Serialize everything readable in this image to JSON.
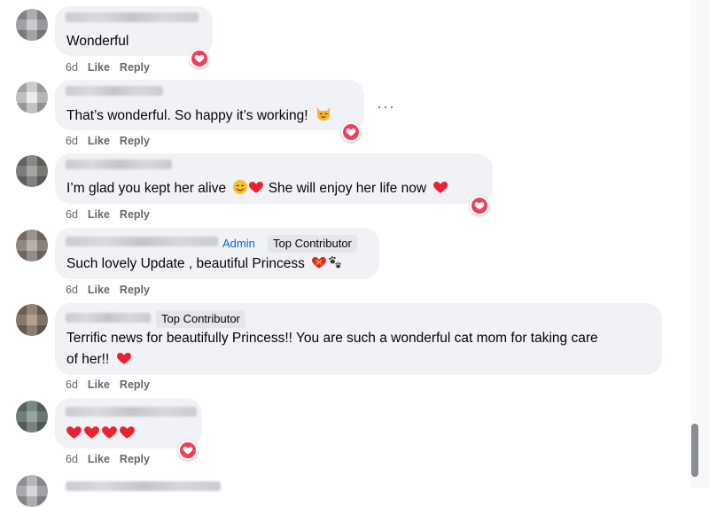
{
  "comments": [
    {
      "text": "Wonderful",
      "time": "6d",
      "like": "Like",
      "reply": "Reply"
    },
    {
      "text": "That’s wonderful. So happy it’s working!",
      "emoji": "cat-smile-icon",
      "time": "6d",
      "like": "Like",
      "reply": "Reply"
    },
    {
      "text_a": "I’m glad you kept her alive",
      "text_b": "She will enjoy her life now",
      "time": "6d",
      "like": "Like",
      "reply": "Reply"
    },
    {
      "badge_admin": "Admin",
      "badge_contrib": "Top Contributor",
      "text": "Such lovely Update , beautiful Princess",
      "time": "6d",
      "like": "Like",
      "reply": "Reply"
    },
    {
      "badge_contrib": "Top Contributor",
      "line1": "Terrific news for beautifully Princess!! You are such a wonderful cat mom for taking care",
      "line2": "of her!!",
      "time": "6d",
      "like": "Like",
      "reply": "Reply"
    },
    {
      "time": "6d",
      "like": "Like",
      "reply": "Reply"
    }
  ],
  "more_options_label": "···",
  "colors": {
    "bubble": "#f0f2f5",
    "love": "#f33e58",
    "admin": "#0866ff",
    "meta": "#65676b"
  }
}
